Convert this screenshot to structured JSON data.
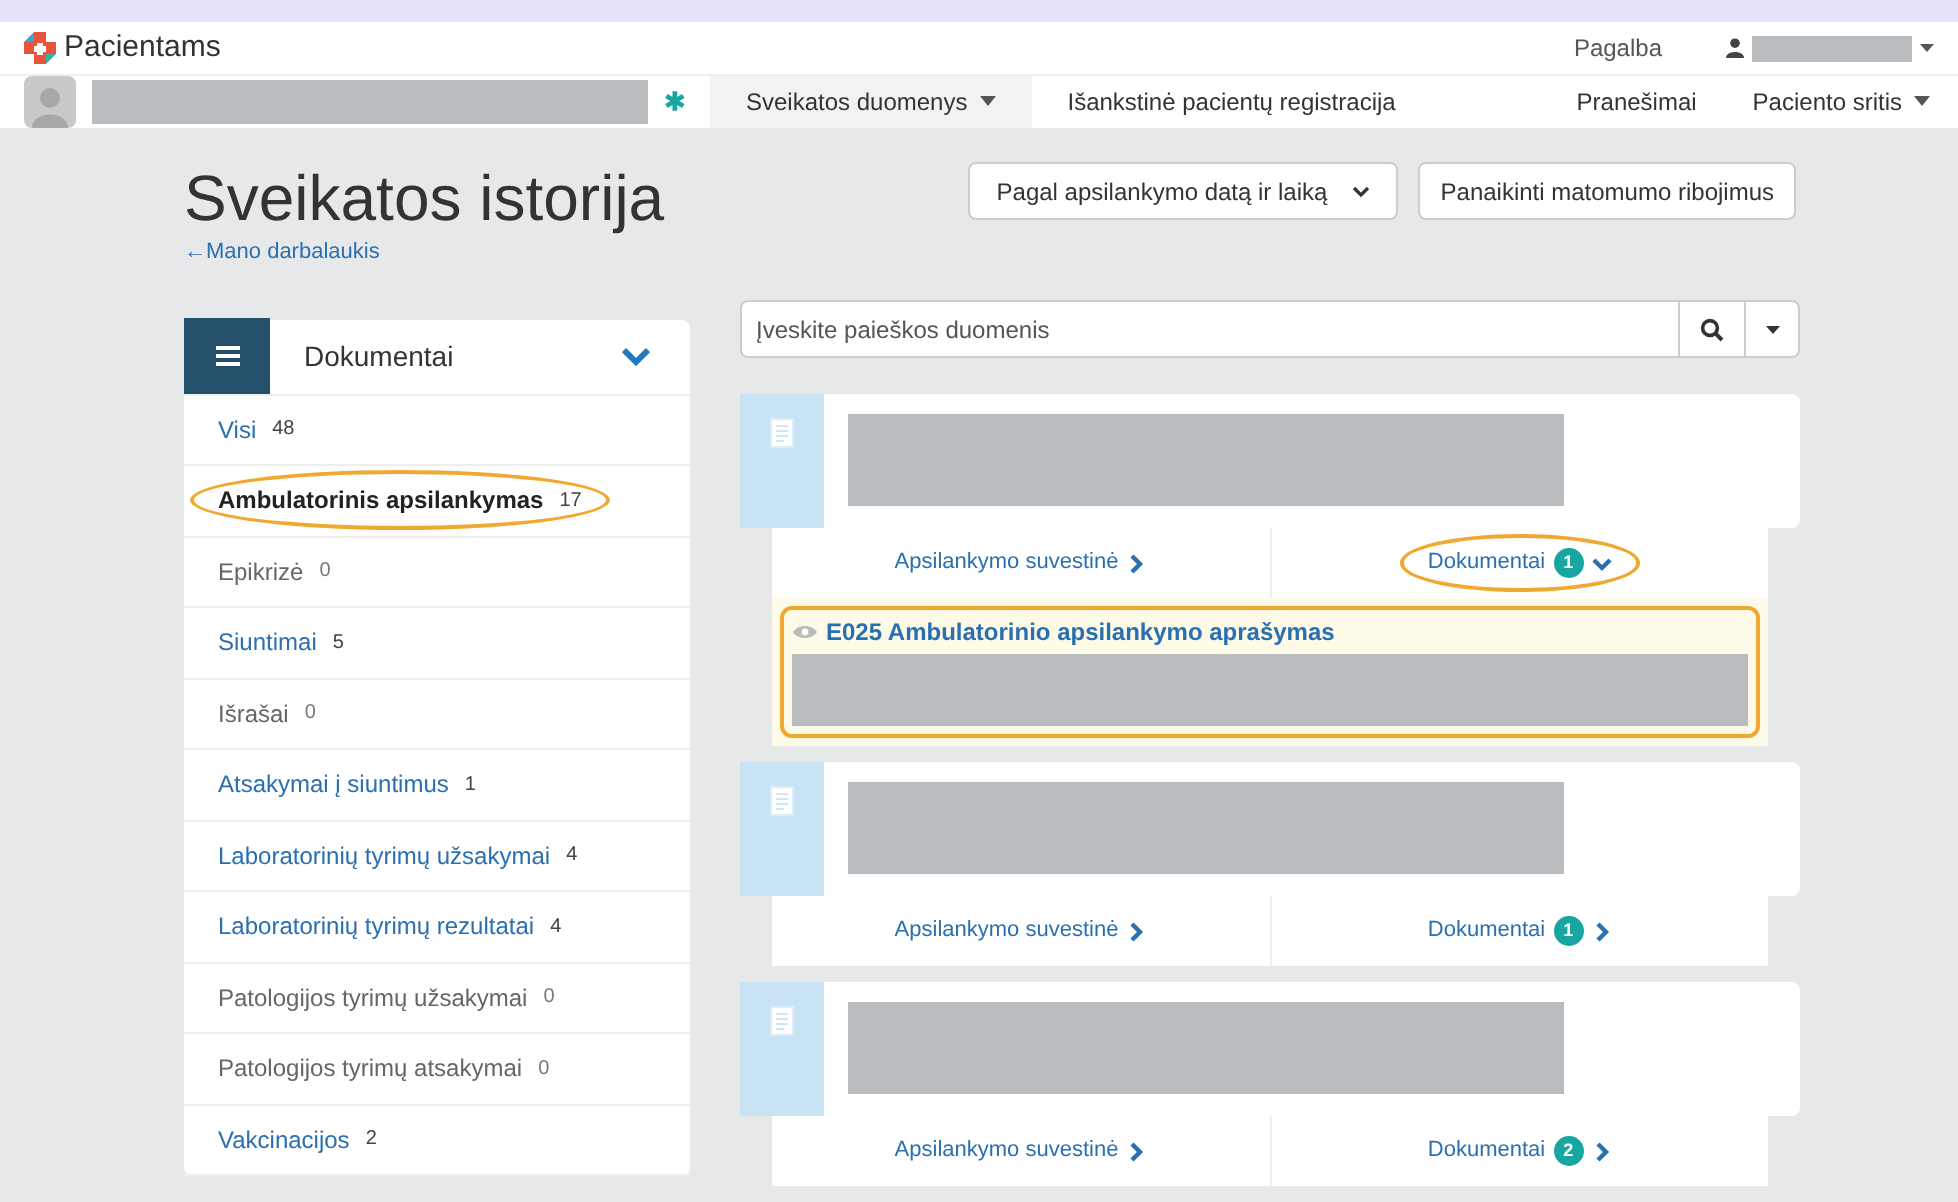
{
  "brand": {
    "name": "Pacientams"
  },
  "top_links": [
    {
      "label": "Pagalba"
    }
  ],
  "nav": {
    "items": [
      {
        "label": "Sveikatos duomenys",
        "dropdown": true,
        "selected": true
      },
      {
        "label": "Išankstinė pacientų registracija",
        "dropdown": false,
        "selected": false
      }
    ],
    "right_items": [
      {
        "label": "Pranešimai",
        "dropdown": false
      },
      {
        "label": "Paciento sritis",
        "dropdown": true
      }
    ]
  },
  "page": {
    "title": "Sveikatos istorija",
    "back_link": "←Mano darbalaukis"
  },
  "sort_select": {
    "value": "Pagal apsilankymo datą ir laiką"
  },
  "clear_button": {
    "label": "Panaikinti matomumo ribojimus"
  },
  "sidebar": {
    "title": "Dokumentai",
    "expanded": true,
    "items": [
      {
        "label": "Visi",
        "count": "48",
        "selected": false,
        "disabled": false,
        "highlighted": false
      },
      {
        "label": "Ambulatorinis apsilankymas",
        "count": "17",
        "selected": true,
        "disabled": false,
        "highlighted": true
      },
      {
        "label": "Epikrizė",
        "count": "0",
        "selected": false,
        "disabled": true,
        "highlighted": false
      },
      {
        "label": "Siuntimai",
        "count": "5",
        "selected": false,
        "disabled": false,
        "highlighted": false
      },
      {
        "label": "Išrašai",
        "count": "0",
        "selected": false,
        "disabled": true,
        "highlighted": false
      },
      {
        "label": "Atsakymai į siuntimus",
        "count": "1",
        "selected": false,
        "disabled": false,
        "highlighted": false
      },
      {
        "label": "Laboratorinių tyrimų užsakymai",
        "count": "4",
        "selected": false,
        "disabled": false,
        "highlighted": false
      },
      {
        "label": "Laboratorinių tyrimų rezultatai",
        "count": "4",
        "selected": false,
        "disabled": false,
        "highlighted": false
      },
      {
        "label": "Patologijos tyrimų užsakymai",
        "count": "0",
        "selected": false,
        "disabled": true,
        "highlighted": false
      },
      {
        "label": "Patologijos tyrimų atsakymai",
        "count": "0",
        "selected": false,
        "disabled": true,
        "highlighted": false
      },
      {
        "label": "Vakcinacijos",
        "count": "2",
        "selected": false,
        "disabled": false,
        "highlighted": false
      }
    ]
  },
  "search": {
    "placeholder": "Įveskite paieškos duomenis"
  },
  "visits": [
    {
      "summary_link": "Apsilankymo suvestinė",
      "documents_label": "Dokumentai",
      "documents_count": "1",
      "expanded": true,
      "highlighted": true,
      "documents": [
        {
          "title": "E025 Ambulatorinio apsilankymo aprašymas",
          "highlighted": true
        }
      ]
    },
    {
      "summary_link": "Apsilankymo suvestinė",
      "documents_label": "Dokumentai",
      "documents_count": "1",
      "expanded": false,
      "highlighted": false
    },
    {
      "summary_link": "Apsilankymo suvestinė",
      "documents_label": "Dokumentai",
      "documents_count": "2",
      "expanded": false,
      "highlighted": false
    }
  ]
}
